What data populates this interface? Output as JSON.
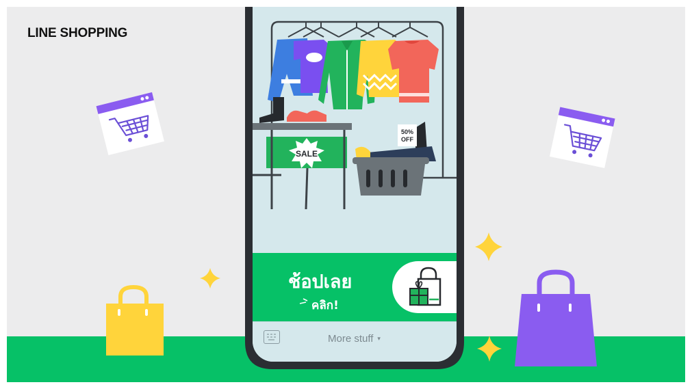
{
  "brand": "LINE SHOPPING",
  "colors": {
    "green": "#06c167",
    "purple": "#8a5cf0",
    "yellow": "#ffd43b",
    "phone_frame": "#2b2e33",
    "screen_bg": "#d5e8ec"
  },
  "store": {
    "sale_sign": "SALE",
    "discount_tag_line1": "50%",
    "discount_tag_line2": "OFF"
  },
  "cta": {
    "main": "ช้อปเลย",
    "sub": "คลิก!",
    "icon": "gift-bag-icon"
  },
  "bottom_bar": {
    "keyboard_icon": "keyboard-icon",
    "menu_label": "More stuff",
    "caret": "▾"
  },
  "decorations": {
    "cart_icon": "shopping-cart-window-icon",
    "sparkle_icon": "sparkle-icon",
    "bag_icon": "shopping-bag-icon"
  }
}
